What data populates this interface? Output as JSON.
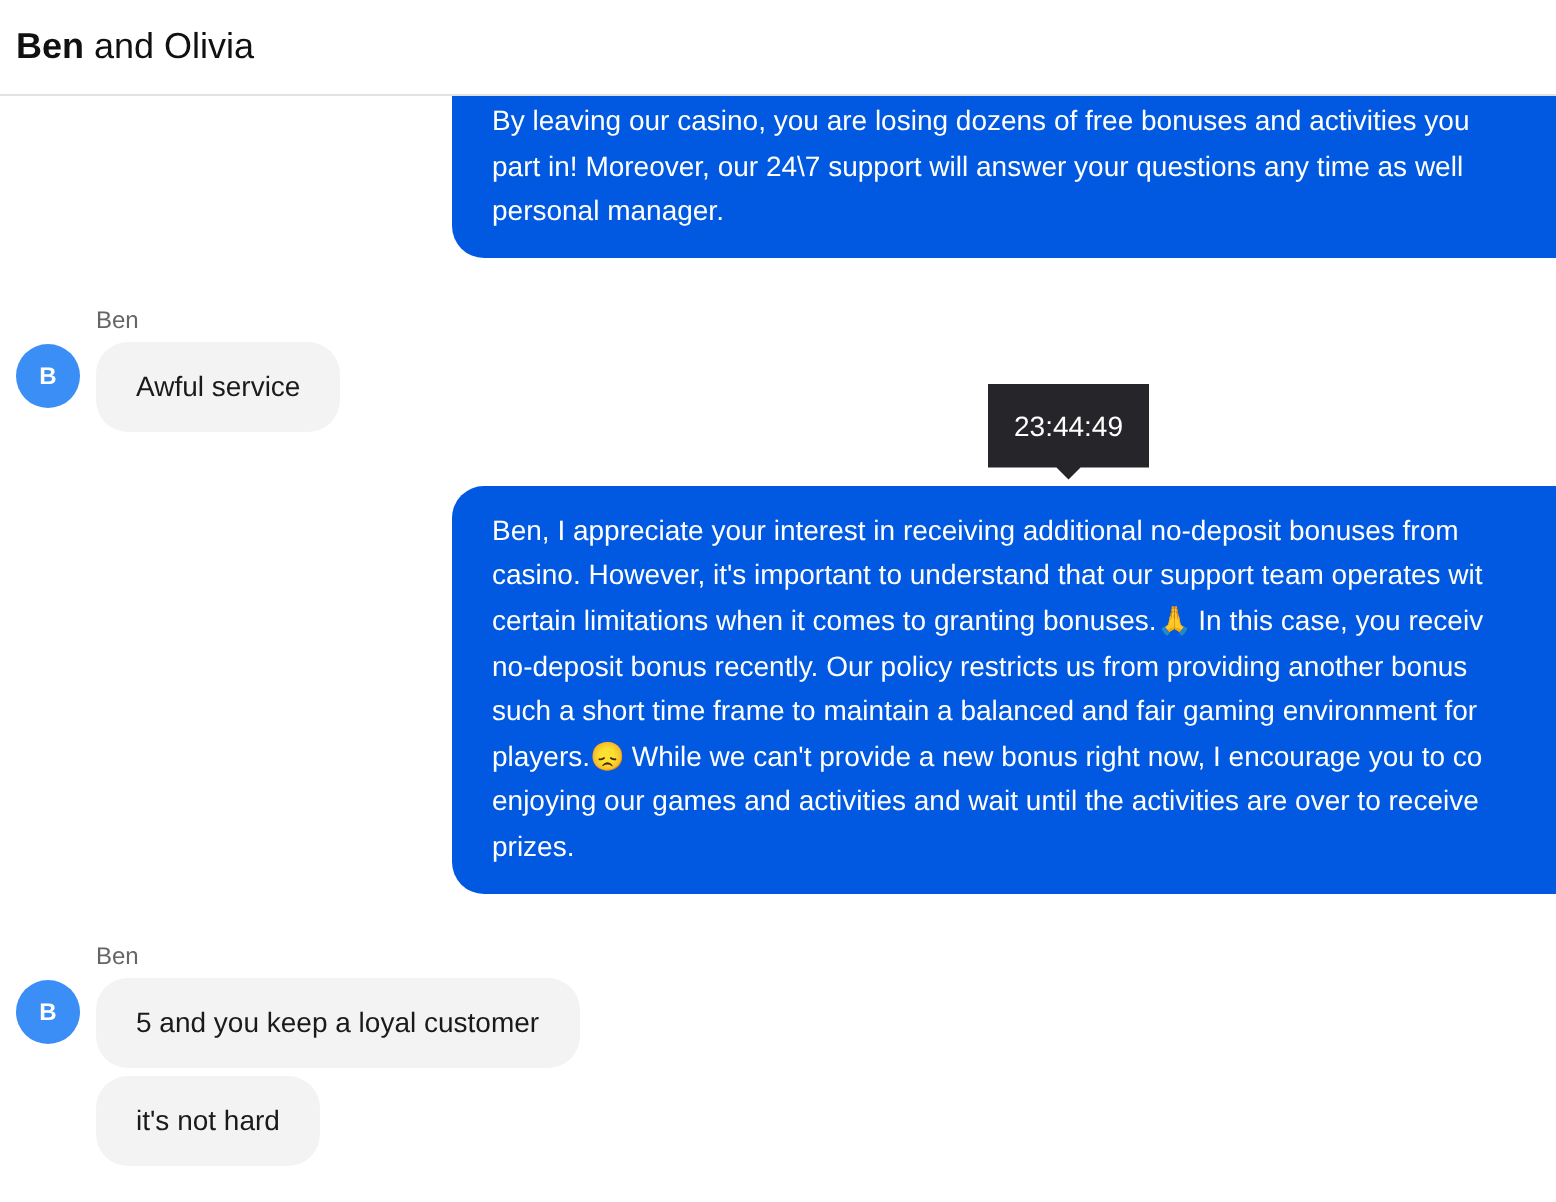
{
  "header": {
    "title": "**Ben** and Olivia"
  },
  "messages": [
    {
      "kind": "outgoing",
      "lines": [
        "By leaving our casino, you are losing dozens of free bonuses and activities you",
        "part in! Moreover, our 24\\7 support will answer your questions any time as well",
        "personal manager."
      ]
    },
    {
      "kind": "incoming",
      "sender": "Ben",
      "avatar": "B",
      "bubbles": [
        "Awful service"
      ]
    },
    {
      "kind": "outgoing",
      "tooltip": "23:44:49",
      "lines": [
        "Ben, I appreciate your interest in receiving additional no-deposit bonuses from",
        "casino. However, it's important to understand that our support team operates wit",
        "certain limitations when it comes to granting bonuses.🙏 In this case, you receiv",
        "no-deposit bonus recently. Our policy restricts us from providing another bonus",
        "such a short time frame to maintain a balanced and fair gaming environment for",
        "players.😞 While we can't provide a new bonus right now, I encourage you to co",
        "enjoying our games and activities and wait until the activities are over to receive",
        "prizes."
      ]
    },
    {
      "kind": "incoming",
      "sender": "Ben",
      "avatar": "B",
      "bubbles": [
        "5 and you keep a loyal customer",
        "it's not hard"
      ]
    }
  ]
}
